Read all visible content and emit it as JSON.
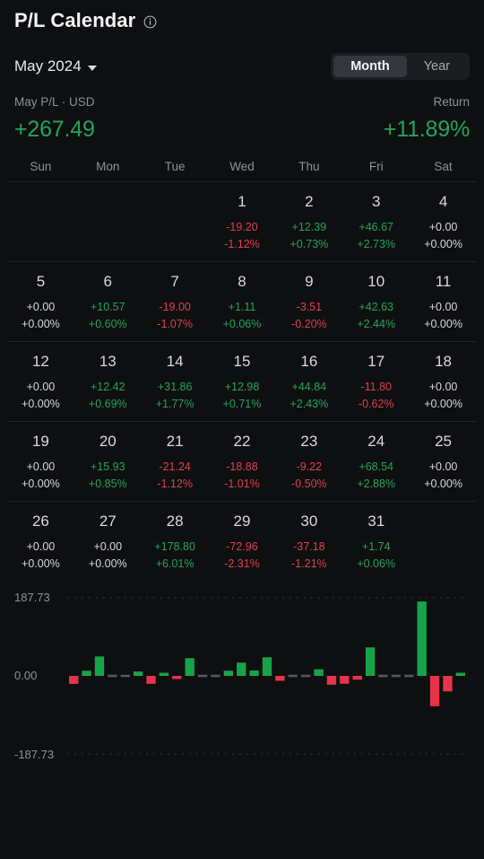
{
  "header": {
    "title": "P/L Calendar",
    "info_icon": "info-circle-icon"
  },
  "controls": {
    "month_label": "May 2024",
    "caret_icon": "chevron-down-icon",
    "toggle": {
      "options": [
        "Month",
        "Year"
      ],
      "selected": "Month"
    }
  },
  "summary": {
    "pl_label": "May P/L · USD",
    "return_label": "Return",
    "pl_value": "+267.49",
    "return_value": "+11.89%"
  },
  "calendar": {
    "weekday_headers": [
      "Sun",
      "Mon",
      "Tue",
      "Wed",
      "Thu",
      "Fri",
      "Sat"
    ],
    "weeks": [
      [
        {
          "day": "",
          "pl": "",
          "pct": "",
          "sign": "empty"
        },
        {
          "day": "",
          "pl": "",
          "pct": "",
          "sign": "empty"
        },
        {
          "day": "",
          "pl": "",
          "pct": "",
          "sign": "empty"
        },
        {
          "day": "1",
          "pl": "-19.20",
          "pct": "-1.12%",
          "sign": "neg"
        },
        {
          "day": "2",
          "pl": "+12.39",
          "pct": "+0.73%",
          "sign": "pos"
        },
        {
          "day": "3",
          "pl": "+46.67",
          "pct": "+2.73%",
          "sign": "pos"
        },
        {
          "day": "4",
          "pl": "+0.00",
          "pct": "+0.00%",
          "sign": "neutral"
        }
      ],
      [
        {
          "day": "5",
          "pl": "+0.00",
          "pct": "+0.00%",
          "sign": "neutral"
        },
        {
          "day": "6",
          "pl": "+10.57",
          "pct": "+0.60%",
          "sign": "pos"
        },
        {
          "day": "7",
          "pl": "-19.00",
          "pct": "-1.07%",
          "sign": "neg"
        },
        {
          "day": "8",
          "pl": "+1.11",
          "pct": "+0.06%",
          "sign": "pos"
        },
        {
          "day": "9",
          "pl": "-3.51",
          "pct": "-0.20%",
          "sign": "neg"
        },
        {
          "day": "10",
          "pl": "+42.63",
          "pct": "+2.44%",
          "sign": "pos"
        },
        {
          "day": "11",
          "pl": "+0.00",
          "pct": "+0.00%",
          "sign": "neutral"
        }
      ],
      [
        {
          "day": "12",
          "pl": "+0.00",
          "pct": "+0.00%",
          "sign": "neutral"
        },
        {
          "day": "13",
          "pl": "+12.42",
          "pct": "+0.69%",
          "sign": "pos"
        },
        {
          "day": "14",
          "pl": "+31.86",
          "pct": "+1.77%",
          "sign": "pos"
        },
        {
          "day": "15",
          "pl": "+12.98",
          "pct": "+0.71%",
          "sign": "pos"
        },
        {
          "day": "16",
          "pl": "+44.84",
          "pct": "+2.43%",
          "sign": "pos"
        },
        {
          "day": "17",
          "pl": "-11.80",
          "pct": "-0.62%",
          "sign": "neg"
        },
        {
          "day": "18",
          "pl": "+0.00",
          "pct": "+0.00%",
          "sign": "neutral"
        }
      ],
      [
        {
          "day": "19",
          "pl": "+0.00",
          "pct": "+0.00%",
          "sign": "neutral"
        },
        {
          "day": "20",
          "pl": "+15.93",
          "pct": "+0.85%",
          "sign": "pos"
        },
        {
          "day": "21",
          "pl": "-21.24",
          "pct": "-1.12%",
          "sign": "neg"
        },
        {
          "day": "22",
          "pl": "-18.88",
          "pct": "-1.01%",
          "sign": "neg"
        },
        {
          "day": "23",
          "pl": "-9.22",
          "pct": "-0.50%",
          "sign": "neg"
        },
        {
          "day": "24",
          "pl": "+68.54",
          "pct": "+2.88%",
          "sign": "pos"
        },
        {
          "day": "25",
          "pl": "+0.00",
          "pct": "+0.00%",
          "sign": "neutral"
        }
      ],
      [
        {
          "day": "26",
          "pl": "+0.00",
          "pct": "+0.00%",
          "sign": "neutral"
        },
        {
          "day": "27",
          "pl": "+0.00",
          "pct": "+0.00%",
          "sign": "neutral"
        },
        {
          "day": "28",
          "pl": "+178.80",
          "pct": "+6.01%",
          "sign": "pos"
        },
        {
          "day": "29",
          "pl": "-72.96",
          "pct": "-2.31%",
          "sign": "neg"
        },
        {
          "day": "30",
          "pl": "-37.18",
          "pct": "-1.21%",
          "sign": "neg"
        },
        {
          "day": "31",
          "pl": "+1.74",
          "pct": "+0.06%",
          "sign": "pos"
        },
        {
          "day": "",
          "pl": "",
          "pct": "",
          "sign": "empty"
        }
      ]
    ]
  },
  "colors": {
    "background": "#0e0f11",
    "positive": "#22a45d",
    "negative": "#e03f4e",
    "neutral": "#d8d9dc",
    "muted": "#8e9197",
    "grid": "#2a2c31"
  },
  "chart_data": {
    "type": "bar",
    "title": "",
    "xlabel": "",
    "ylabel": "",
    "ylim": [
      -187.73,
      187.73
    ],
    "grid": true,
    "legend": null,
    "axis_tick_labels": [
      "187.73",
      "0.00",
      "-187.73"
    ],
    "categories": [
      "1",
      "2",
      "3",
      "4",
      "5",
      "6",
      "7",
      "8",
      "9",
      "10",
      "11",
      "12",
      "13",
      "14",
      "15",
      "16",
      "17",
      "18",
      "19",
      "20",
      "21",
      "22",
      "23",
      "24",
      "25",
      "26",
      "27",
      "28",
      "29",
      "30",
      "31"
    ],
    "values": [
      -19.2,
      12.39,
      46.67,
      0.0,
      0.0,
      10.57,
      -19.0,
      1.11,
      -3.51,
      42.63,
      0.0,
      0.0,
      12.42,
      31.86,
      12.98,
      44.84,
      -11.8,
      0.0,
      0.0,
      15.93,
      -21.24,
      -18.88,
      -9.22,
      68.54,
      0.0,
      0.0,
      0.0,
      178.8,
      -72.96,
      -37.18,
      1.74
    ],
    "positive_color": "#17a34a",
    "negative_color": "#e8334a",
    "zero_color": "#6b7280"
  }
}
